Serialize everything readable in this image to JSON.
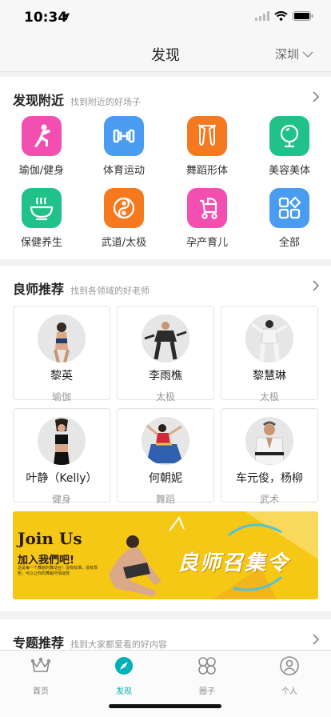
{
  "status": {
    "time": "10:34"
  },
  "nav": {
    "title": "发现",
    "city": "深圳"
  },
  "nearby": {
    "title": "发现附近",
    "subtitle": "找到附近的好场子",
    "categories": [
      {
        "label": "瑜伽/健身",
        "icon": "yoga-icon",
        "color": "#f24fb1"
      },
      {
        "label": "体育运动",
        "icon": "dumbbell-icon",
        "color": "#4a9cf0"
      },
      {
        "label": "舞蹈形体",
        "icon": "ballet-shoes-icon",
        "color": "#f57a1f"
      },
      {
        "label": "美容美体",
        "icon": "mirror-icon",
        "color": "#21c28a"
      },
      {
        "label": "保健养生",
        "icon": "health-bowl-icon",
        "color": "#21c28a"
      },
      {
        "label": "武道/太极",
        "icon": "taiji-icon",
        "color": "#f57a1f"
      },
      {
        "label": "孕产育儿",
        "icon": "stroller-icon",
        "color": "#f24fb1"
      },
      {
        "label": "全部",
        "icon": "grid-icon",
        "color": "#4a9cf0"
      }
    ]
  },
  "teachers": {
    "title": "良师推荐",
    "subtitle": "找到各领域的好老师",
    "items": [
      {
        "name": "黎英",
        "field": "瑜伽"
      },
      {
        "name": "李雨樵",
        "field": "太极"
      },
      {
        "name": "黎慧琳",
        "field": "太极"
      },
      {
        "name": "叶静（Kelly）",
        "field": "健身"
      },
      {
        "name": "何朝妮",
        "field": "舞蹈"
      },
      {
        "name": "车元俊，杨柳",
        "field": "武术"
      }
    ]
  },
  "banner": {
    "join": "Join Us",
    "join_cn": "加入我們吧!",
    "fine_print": "这是每一个舞蹈的舞动台！没有标准，没有规矩，可以让你的舞蹈尽情绽放",
    "slogan": "良师召集令"
  },
  "topics": {
    "title": "专题推荐",
    "subtitle": "找到大家都爱看的好内容"
  },
  "tabbar": {
    "active": 1,
    "items": [
      {
        "label": "首页",
        "icon": "crown-icon"
      },
      {
        "label": "发现",
        "icon": "compass-icon"
      },
      {
        "label": "圈子",
        "icon": "circles-grid-icon"
      },
      {
        "label": "个人",
        "icon": "person-icon"
      }
    ]
  },
  "colors": {
    "accent": "#00b0b8",
    "banner_bg": "#f5c816"
  }
}
